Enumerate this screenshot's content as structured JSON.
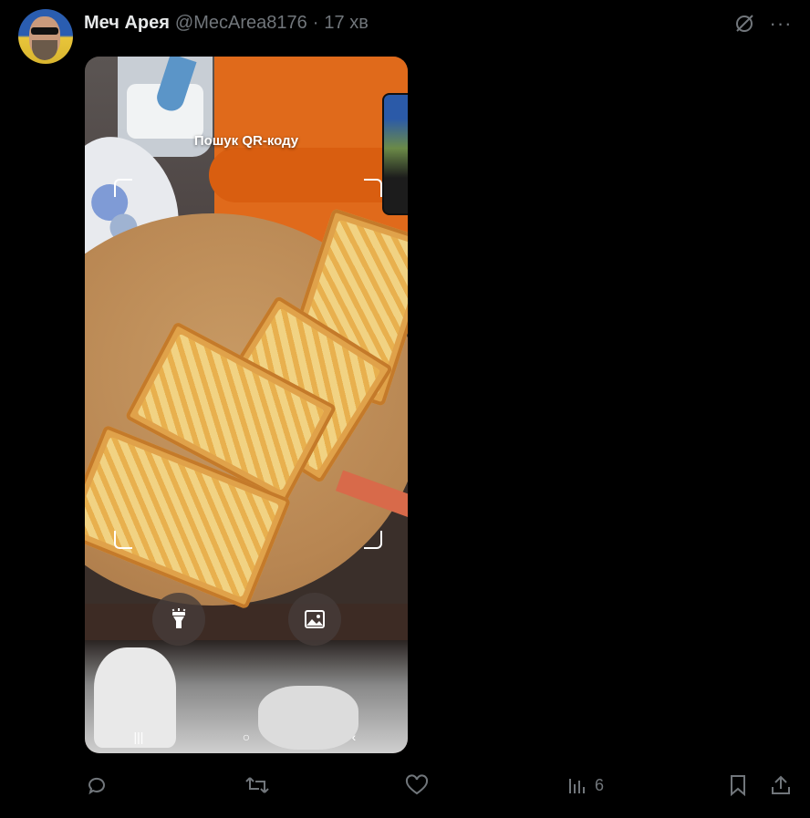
{
  "post": {
    "author_name": "Меч Арея",
    "author_handle": "@MecArea8176",
    "separator": "·",
    "timestamp": "17 хв"
  },
  "media": {
    "qr_label": "Пошук QR-коду",
    "flashlight_icon": "flashlight-icon",
    "gallery_icon": "image-icon",
    "nav": {
      "recents": "|||",
      "home": "○",
      "back": "‹"
    }
  },
  "actions": {
    "views_count": "6"
  },
  "colors": {
    "background": "#000000",
    "text_primary": "#e7e9ea",
    "text_secondary": "#71767b"
  }
}
